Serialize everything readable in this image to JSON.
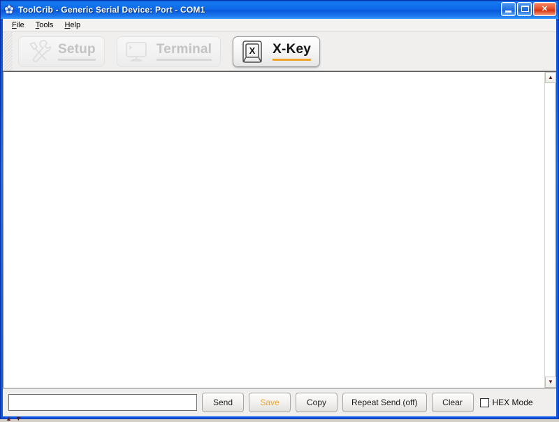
{
  "window": {
    "title": "ToolCrib - Generic Serial Device: Port - COM1",
    "app_icon": "toolcrib-app-icon",
    "controls": {
      "minimize": "minimize-icon",
      "maximize": "maximize-icon",
      "close_label": "✕"
    }
  },
  "menu": {
    "items": [
      {
        "label": "File",
        "accel": "F",
        "rest": "ile"
      },
      {
        "label": "Tools",
        "accel": "T",
        "rest": "ools"
      },
      {
        "label": "Help",
        "accel": "H",
        "rest": "elp"
      }
    ]
  },
  "toolbar": {
    "buttons": [
      {
        "label": "Setup",
        "icon": "tools-wrench-hammer-icon",
        "state": "disabled",
        "underline_color": "#d8d8d8"
      },
      {
        "label": "Terminal",
        "icon": "monitor-terminal-icon",
        "state": "disabled",
        "underline_color": "#d8d8d8"
      },
      {
        "label": "X-Key",
        "icon": "keyboard-key-x-icon",
        "state": "active",
        "underline_color": "#f0a32a"
      }
    ]
  },
  "output": {
    "text": "",
    "scrollbar": {
      "up_arrow": "▲",
      "down_arrow": "▼"
    }
  },
  "bottom": {
    "send_input": {
      "value": "",
      "placeholder": ""
    },
    "buttons": [
      {
        "label": "Send",
        "name": "send-button",
        "style": "normal"
      },
      {
        "label": "Save",
        "name": "save-button",
        "style": "dim"
      },
      {
        "label": "Copy",
        "name": "copy-button",
        "style": "normal"
      },
      {
        "label": "Repeat Send (off)",
        "name": "repeat-send-button",
        "style": "normal"
      },
      {
        "label": "Clear",
        "name": "clear-button",
        "style": "normal"
      }
    ],
    "hex_mode": {
      "label": "HEX Mode",
      "checked": false
    },
    "corner": {
      "up": "▲",
      "down": "▼"
    }
  },
  "colors": {
    "titlebar_blue": "#0e6ae8",
    "accent_orange": "#f0a32a",
    "toolbar_bg": "#f0efed",
    "content_bg": "#ffffff"
  }
}
